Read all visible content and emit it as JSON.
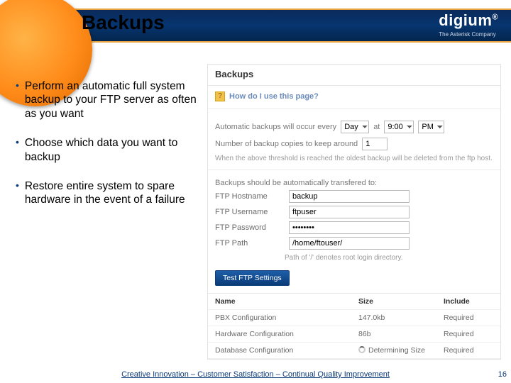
{
  "header": {
    "title": "Backups",
    "logo": "digium",
    "logo_sub": "The Asterisk Company"
  },
  "bullets": [
    "Perform an automatic full system backup to your FTP server as often as you want",
    "Choose which data you want to backup",
    "Restore entire system to spare hardware in the event of a failure"
  ],
  "panel": {
    "heading": "Backups",
    "help": "How do I use this page?",
    "freq_pre": "Automatic backups will occur every",
    "freq_value": "Day",
    "freq_mid": "at",
    "time_value": "9:00",
    "ampm_value": "PM",
    "copies_pre": "Number of backup copies to keep around",
    "copies_value": "1",
    "copies_note": "When the above threshold is reached the oldest backup will be deleted from the ftp host.",
    "transfer_head": "Backups should be automatically transfered to:",
    "ftp_host_label": "FTP Hostname",
    "ftp_host_value": "backup",
    "ftp_user_label": "FTP Username",
    "ftp_user_value": "ftpuser",
    "ftp_pass_label": "FTP Password",
    "ftp_pass_value": "••••••••",
    "ftp_path_label": "FTP Path",
    "ftp_path_value": "/home/ftouser/",
    "ftp_path_note": "Path of '/' denotes root login directory.",
    "test_btn": "Test FTP Settings",
    "table": {
      "cols": [
        "Name",
        "Size",
        "Include"
      ],
      "rows": [
        {
          "name": "PBX Configuration",
          "size": "147.0kb",
          "include": "Required"
        },
        {
          "name": "Hardware Configuration",
          "size": "86b",
          "include": "Required"
        },
        {
          "name": "Database Configuration",
          "size": "Determining Size",
          "include": "Required",
          "loading": true
        }
      ]
    }
  },
  "footer": "Creative Innovation – Customer Satisfaction – Continual Quality Improvement",
  "page_number": "16"
}
